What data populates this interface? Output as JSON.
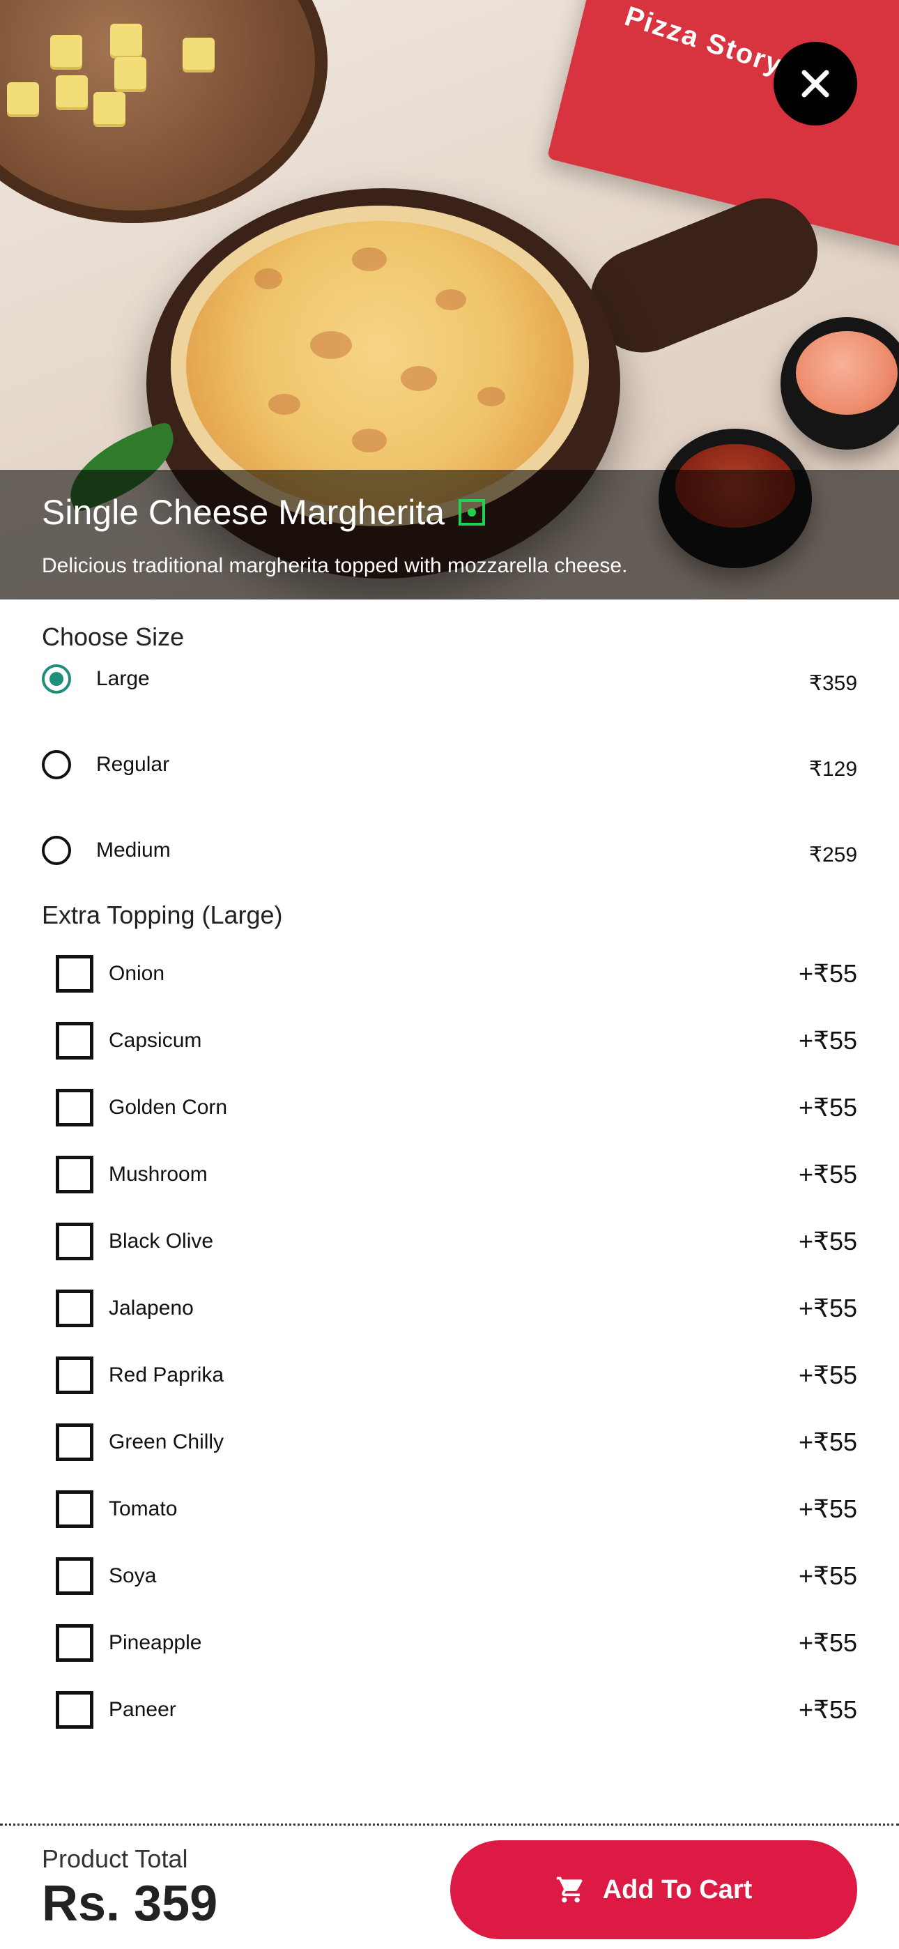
{
  "product": {
    "title": "Single Cheese Margherita",
    "description": "Delicious traditional margherita topped with mozzarella cheese."
  },
  "size_section": {
    "title": "Choose Size",
    "options": [
      {
        "label": "Large",
        "price": "₹359",
        "selected": true
      },
      {
        "label": "Regular",
        "price": "₹129",
        "selected": false
      },
      {
        "label": "Medium",
        "price": "₹259",
        "selected": false
      }
    ]
  },
  "toppings_section": {
    "title": "Extra Topping (Large)",
    "items": [
      {
        "label": "Onion",
        "price": "+₹55"
      },
      {
        "label": "Capsicum",
        "price": "+₹55"
      },
      {
        "label": "Golden Corn",
        "price": "+₹55"
      },
      {
        "label": "Mushroom",
        "price": "+₹55"
      },
      {
        "label": "Black Olive",
        "price": "+₹55"
      },
      {
        "label": "Jalapeno",
        "price": "+₹55"
      },
      {
        "label": "Red Paprika",
        "price": "+₹55"
      },
      {
        "label": "Green Chilly",
        "price": "+₹55"
      },
      {
        "label": "Tomato",
        "price": "+₹55"
      },
      {
        "label": "Soya",
        "price": "+₹55"
      },
      {
        "label": "Pineapple",
        "price": "+₹55"
      },
      {
        "label": "Paneer",
        "price": "+₹55"
      }
    ]
  },
  "footer": {
    "total_label": "Product Total",
    "total_value": "Rs. 359",
    "add_to_cart_label": "Add To Cart"
  },
  "hero_image": {
    "box_text": "Pizza Story"
  },
  "colors": {
    "accent": "#1f8f79",
    "cta": "#dc1a44",
    "veg": "#1fd24f"
  }
}
